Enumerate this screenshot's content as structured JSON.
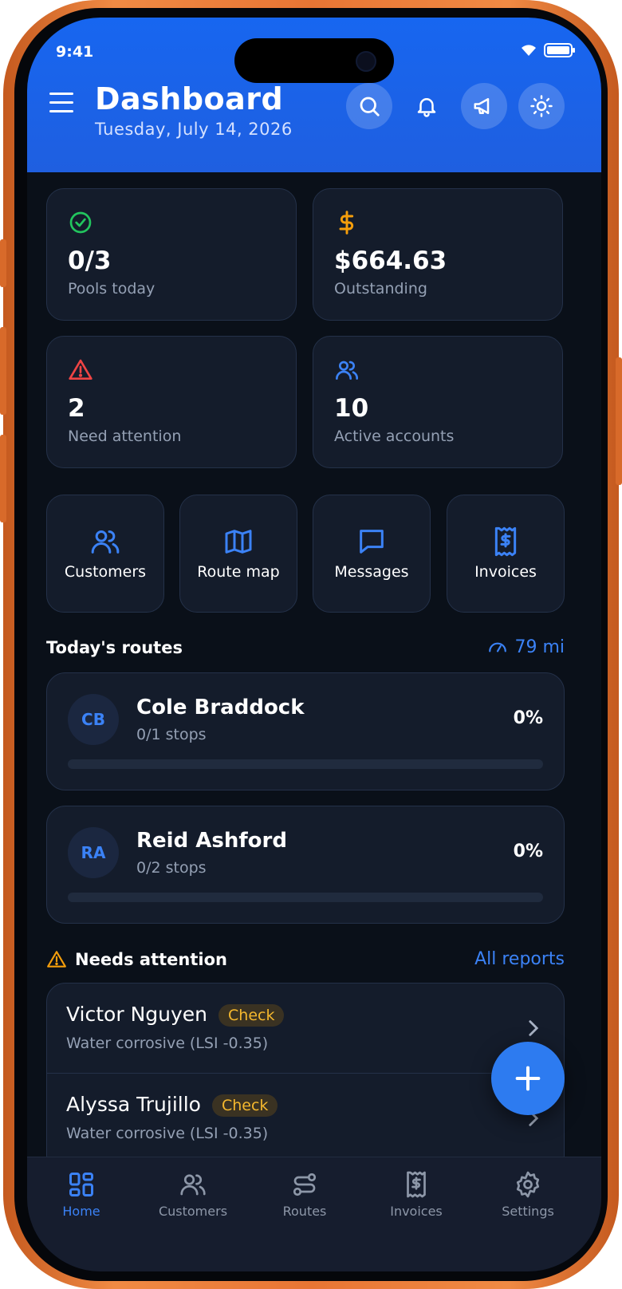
{
  "status_bar": {
    "time": "9:41"
  },
  "header": {
    "title": "Dashboard",
    "date": "Tuesday, July 14, 2026"
  },
  "stats": [
    {
      "value": "0/3",
      "label": "Pools today",
      "icon": "check-circle-icon",
      "color": "#22c55e"
    },
    {
      "value": "$664.63",
      "label": "Outstanding",
      "icon": "dollar-icon",
      "color": "#f59e0b"
    },
    {
      "value": "2",
      "label": "Need attention",
      "icon": "alert-triangle-icon",
      "color": "#ef4444"
    },
    {
      "value": "10",
      "label": "Active accounts",
      "icon": "users-icon",
      "color": "#3b82f6"
    }
  ],
  "quick_actions": [
    {
      "label": "Customers",
      "icon": "users-icon"
    },
    {
      "label": "Route map",
      "icon": "map-icon"
    },
    {
      "label": "Messages",
      "icon": "message-icon"
    },
    {
      "label": "Invoices",
      "icon": "invoice-icon"
    }
  ],
  "routes_section": {
    "title": "Today's routes",
    "distance": "79 mi"
  },
  "routes": [
    {
      "initials": "CB",
      "name": "Cole Braddock",
      "stops": "0/1 stops",
      "percent": "0%",
      "progress": 0
    },
    {
      "initials": "RA",
      "name": "Reid Ashford",
      "stops": "0/2 stops",
      "percent": "0%",
      "progress": 0
    }
  ],
  "attention_section": {
    "title": "Needs attention",
    "link": "All reports"
  },
  "attention": [
    {
      "name": "Victor Nguyen",
      "badge": "Check",
      "desc": "Water corrosive (LSI -0.35)"
    },
    {
      "name": "Alyssa Trujillo",
      "badge": "Check",
      "desc": "Water corrosive (LSI -0.35)"
    }
  ],
  "tabs": [
    {
      "label": "Home",
      "active": true
    },
    {
      "label": "Customers",
      "active": false
    },
    {
      "label": "Routes",
      "active": false
    },
    {
      "label": "Invoices",
      "active": false
    },
    {
      "label": "Settings",
      "active": false
    }
  ],
  "colors": {
    "accent": "#3b82f6",
    "header": "#1766f0",
    "background": "#0a1019",
    "card": "#141c2b"
  }
}
